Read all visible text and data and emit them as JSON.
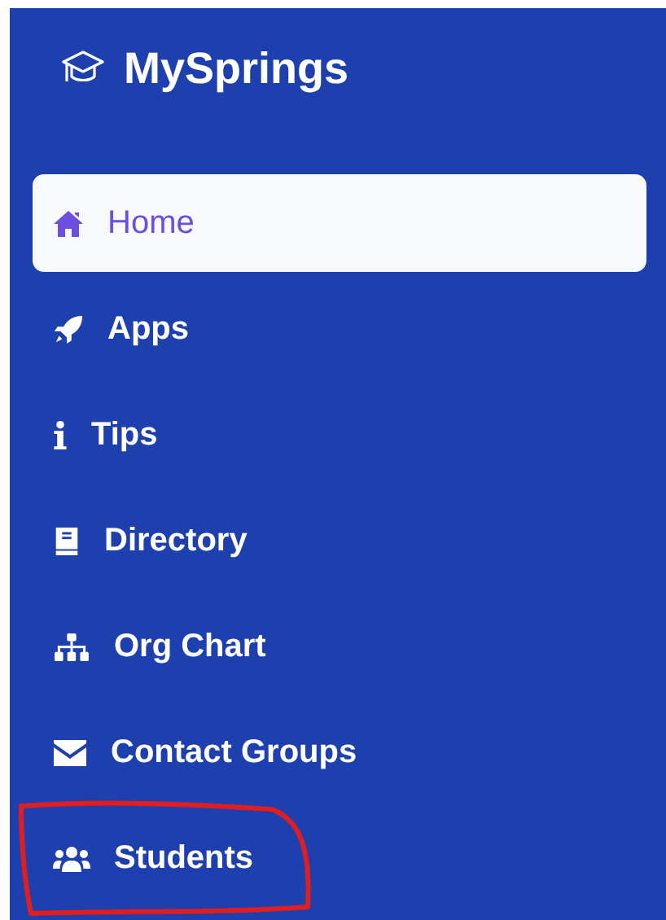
{
  "sidebar": {
    "title": "MySprings",
    "items": [
      {
        "label": "Home",
        "selected": true,
        "circled": false
      },
      {
        "label": "Apps",
        "selected": false,
        "circled": false
      },
      {
        "label": "Tips",
        "selected": false,
        "circled": false
      },
      {
        "label": "Directory",
        "selected": false,
        "circled": false
      },
      {
        "label": "Org Chart",
        "selected": false,
        "circled": false
      },
      {
        "label": "Contact Groups",
        "selected": false,
        "circled": false
      },
      {
        "label": "Students",
        "selected": false,
        "circled": true
      }
    ]
  }
}
